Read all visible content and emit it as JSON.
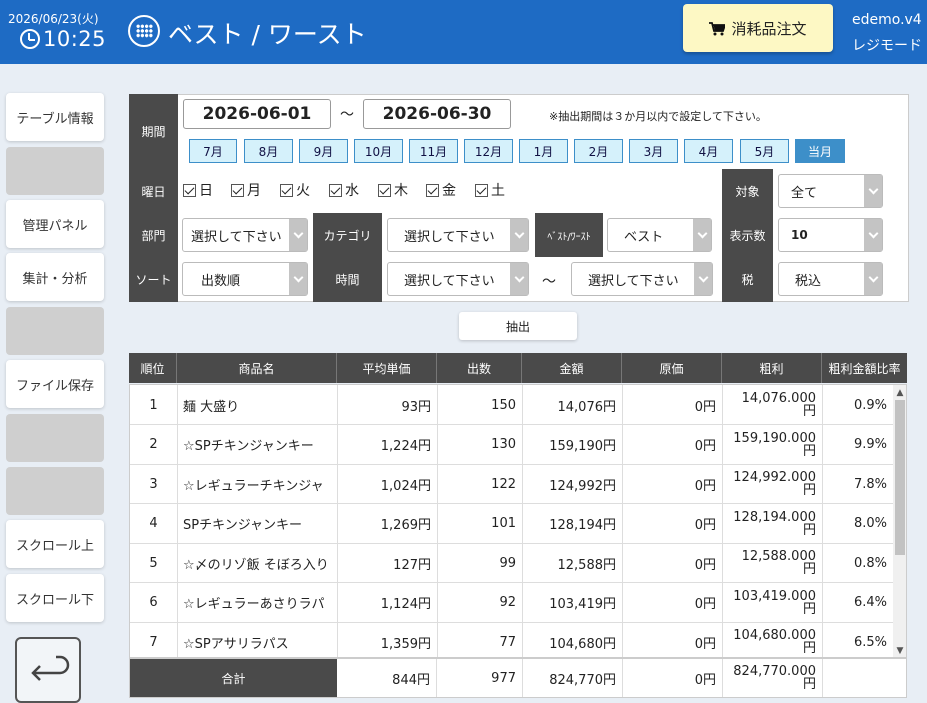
{
  "header": {
    "date": "2026/06/23(火)",
    "time": "10:25",
    "title": "ベスト / ワースト",
    "order_button": "消耗品注文",
    "version": "edemo.v4",
    "mode": "レジモード"
  },
  "sidebar": {
    "items": [
      "テーブル情報",
      "",
      "管理パネル",
      "集計・分析",
      "",
      "ファイル保存",
      "",
      "",
      "スクロール上",
      "スクロール下"
    ]
  },
  "filter": {
    "period_label": "期間",
    "date_from": "2026-06-01",
    "tilde": "～",
    "date_to": "2026-06-30",
    "note": "※抽出期間は３か月以内で設定して下さい。",
    "months": [
      "7月",
      "8月",
      "9月",
      "10月",
      "11月",
      "12月",
      "1月",
      "2月",
      "3月",
      "4月",
      "5月",
      "当月"
    ],
    "active_month": "当月",
    "weekday_label": "曜日",
    "weekdays": [
      "日",
      "月",
      "火",
      "水",
      "木",
      "金",
      "土"
    ],
    "target_label": "対象",
    "target_value": "全て",
    "dept_label": "部門",
    "dept_value": "選択して下さい",
    "category_label": "カテゴリ",
    "category_value": "選択して下さい",
    "bw_label": "ﾍﾞｽﾄ/ﾜｰｽﾄ",
    "bw_value": "ベスト",
    "count_label": "表示数",
    "count_value": "10",
    "sort_label": "ソート",
    "sort_value": "出数順",
    "time_label": "時間",
    "time_from": "選択して下さい",
    "time_tilde": "～",
    "time_to": "選択して下さい",
    "tax_label": "税",
    "tax_value": "税込",
    "extract_button": "抽出"
  },
  "table": {
    "headers": [
      "順位",
      "商品名",
      "平均単価",
      "出数",
      "金額",
      "原価",
      "粗利",
      "粗利金額比率"
    ],
    "rows": [
      [
        "1",
        "麺 大盛り",
        "93円",
        "150",
        "14,076円",
        "0円",
        "14,076.000",
        "円",
        "0.9%"
      ],
      [
        "2",
        "☆SPチキンジャンキー",
        "1,224円",
        "130",
        "159,190円",
        "0円",
        "159,190.000",
        "円",
        "9.9%"
      ],
      [
        "3",
        "☆レギュラーチキンジャ",
        "1,024円",
        "122",
        "124,992円",
        "0円",
        "124,992.000",
        "円",
        "7.8%"
      ],
      [
        "4",
        "SPチキンジャンキー",
        "1,269円",
        "101",
        "128,194円",
        "0円",
        "128,194.000",
        "円",
        "8.0%"
      ],
      [
        "5",
        "☆〆のリゾ飯 そぼろ入り",
        "127円",
        "99",
        "12,588円",
        "0円",
        "12,588.000",
        "円",
        "0.8%"
      ],
      [
        "6",
        "☆レギュラーあさりラパ",
        "1,124円",
        "92",
        "103,419円",
        "0円",
        "103,419.000",
        "円",
        "6.4%"
      ],
      [
        "7",
        "☆SPアサリラパス",
        "1,359円",
        "77",
        "104,680円",
        "0円",
        "104,680.000",
        "円",
        "6.5%"
      ]
    ],
    "total": {
      "label": "合計",
      "avg": "844円",
      "count": "977",
      "amount": "824,770円",
      "cost": "0円",
      "gross_num": "824,770.000",
      "gross_unit": "円"
    }
  },
  "colors": {
    "header_bg": "#1e6bc4",
    "label_bg": "#4a4a4a",
    "month_bg": "#d5f1fb",
    "month_active": "#3d8fc9",
    "order_btn": "#fdf8c4"
  },
  "icons": [
    "clock-icon",
    "grid-menu-icon",
    "cart-icon",
    "back-arrow-icon",
    "chevron-down-icon",
    "checkbox-icon"
  ]
}
